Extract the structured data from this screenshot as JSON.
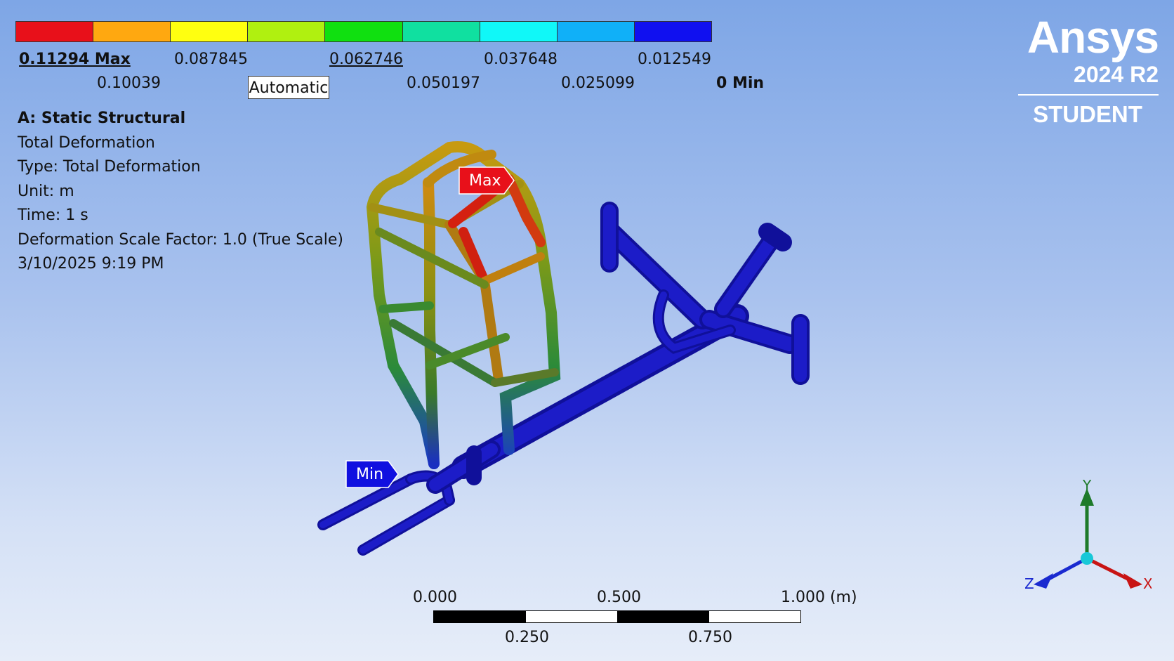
{
  "legend": {
    "colors": [
      "#e8101a",
      "#ffa810",
      "#ffff10",
      "#b0f010",
      "#10e010",
      "#10e0a0",
      "#10f8f8",
      "#10b0f8",
      "#1010f0"
    ],
    "labels_top": [
      "0.11294 Max",
      "0.087845",
      "0.062746",
      "0.037648",
      "0.012549"
    ],
    "labels_bottom": [
      "0.10039",
      "0.050197",
      "0.025099",
      "0 Min"
    ],
    "mode": "Automatic"
  },
  "info": {
    "title": "A: Static Structural",
    "result": "Total Deformation",
    "type": "Type: Total Deformation",
    "unit": "Unit: m",
    "time": "Time: 1 s",
    "scale": "Deformation Scale Factor: 1.0 (True Scale)",
    "date": "3/10/2025 9:19 PM"
  },
  "logo": {
    "brand": "Ansys",
    "version": "2024 R2",
    "edition": "STUDENT"
  },
  "probes": {
    "max": "Max",
    "min": "Min",
    "max_color": "#e8101a",
    "min_color": "#1010e0"
  },
  "scale_bar": {
    "top_labels": [
      "0.000",
      "0.500",
      "1.000 (m)"
    ],
    "bottom_labels": [
      "0.250",
      "0.750"
    ]
  },
  "triad": {
    "x": "X",
    "y": "Y",
    "z": "Z",
    "x_color": "#c81414",
    "y_color": "#1e7a2a",
    "z_color": "#1a2ad0"
  }
}
